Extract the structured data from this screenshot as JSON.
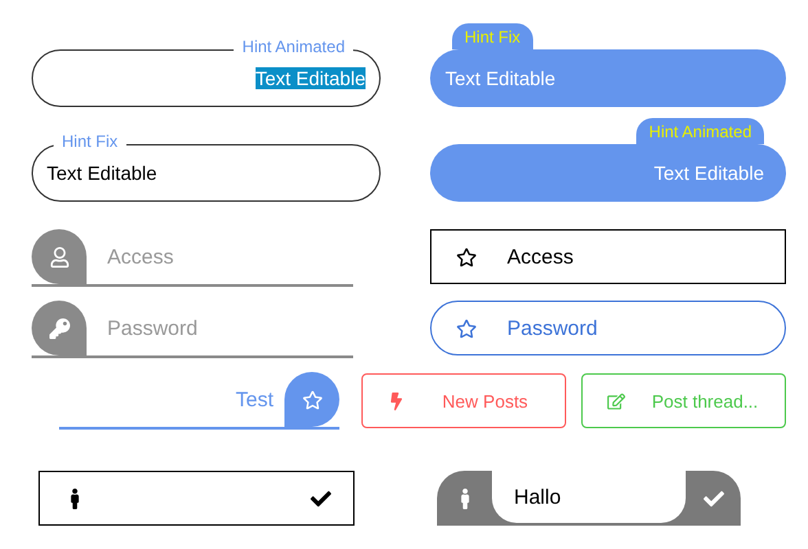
{
  "hint_fields": [
    {
      "kind": "outline",
      "hint": "Hint Animated",
      "animated": true,
      "value": "Text Editable",
      "text_selected": true
    },
    {
      "kind": "filled",
      "hint": "Hint Fix",
      "animated": false,
      "value": "Text Editable",
      "text_selected": false
    },
    {
      "kind": "outline",
      "hint": "Hint Fix",
      "animated": false,
      "value": "Text Editable",
      "text_selected": false
    },
    {
      "kind": "filled",
      "hint": "Hint Animated",
      "animated": true,
      "value": "Text Editable",
      "text_selected": false
    }
  ],
  "icon_fields": [
    {
      "kind": "blob",
      "placeholder": "Access"
    },
    {
      "kind": "box",
      "value": "Access"
    },
    {
      "kind": "blob",
      "placeholder": "Password"
    },
    {
      "kind": "pill",
      "value": "Password"
    }
  ],
  "search": {
    "value": "Test"
  },
  "buttons": [
    {
      "label": "New Posts",
      "color": "#ff5a5a"
    },
    {
      "label": "Post thread...",
      "color": "#4cc94c"
    }
  ],
  "bottom_fields": [
    {
      "kind": "box"
    },
    {
      "kind": "blob",
      "value": "Hallo"
    }
  ]
}
